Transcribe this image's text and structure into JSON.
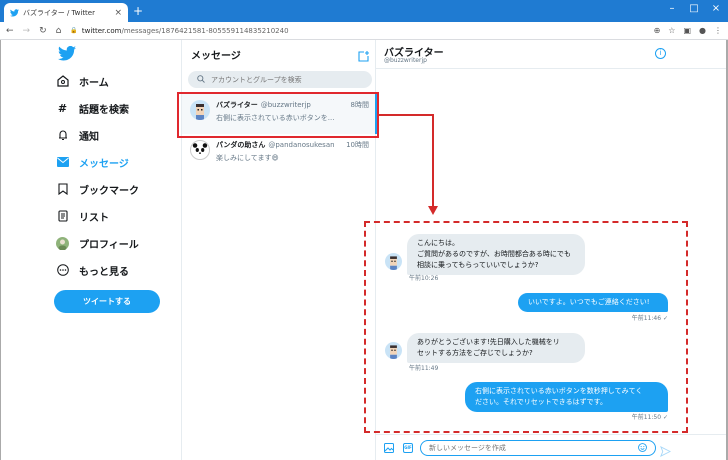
{
  "browser": {
    "tab_title": "バズライター / Twitter",
    "url_domain": "twitter.com",
    "url_path": "/messages/1876421581-805559114835210240"
  },
  "nav": {
    "items": [
      {
        "label": "ホーム",
        "icon": "home-icon"
      },
      {
        "label": "話題を検索",
        "icon": "hashtag-icon"
      },
      {
        "label": "通知",
        "icon": "bell-icon"
      },
      {
        "label": "メッセージ",
        "icon": "mail-icon",
        "active": true
      },
      {
        "label": "ブックマーク",
        "icon": "bookmark-icon"
      },
      {
        "label": "リスト",
        "icon": "list-icon"
      },
      {
        "label": "プロフィール",
        "icon": "avatar-icon"
      },
      {
        "label": "もっと見る",
        "icon": "more-icon"
      }
    ],
    "tweet_button": "ツイートする"
  },
  "messages_panel": {
    "title": "メッセージ",
    "search_placeholder": "アカウントとグループを検索",
    "conversations": [
      {
        "name": "バズライター",
        "handle": "@buzzwriterjp",
        "time": "8時間",
        "preview": "右側に表示されている赤いボタンを..."
      },
      {
        "name": "パンダの助さん",
        "handle": "@pandanosukesan",
        "time": "10時間",
        "preview": "楽しみにしてます😄"
      }
    ]
  },
  "chat": {
    "name": "バズライター",
    "handle": "@buzzwriterjp",
    "messages": [
      {
        "dir": "in",
        "lines": [
          "こんにちは。",
          "ご質問があるのですが、お時間都合ある時にでも",
          "相談に乗ってもらっていいでしょうか?"
        ],
        "time": "午前10:26"
      },
      {
        "dir": "out",
        "lines": [
          "いいですよ。いつでもご連絡ください!"
        ],
        "time": "午前11:46 ✓"
      },
      {
        "dir": "in",
        "lines": [
          "ありがとうございます!先日購入した機械をリ",
          "セットする方法をご存じでしょうか?"
        ],
        "time": "午前11:49"
      },
      {
        "dir": "out",
        "lines": [
          "右側に表示されている赤いボタンを数秒押してみてく",
          "ださい。それでリセットできるはずです。"
        ],
        "time": "午前11:50 ✓"
      }
    ],
    "composer_placeholder": "新しいメッセージを作成",
    "gif_label": "GIF"
  },
  "colors": {
    "accent": "#1da1f2",
    "annotation": "#d42a2a",
    "chrome": "#1f7bd2"
  }
}
